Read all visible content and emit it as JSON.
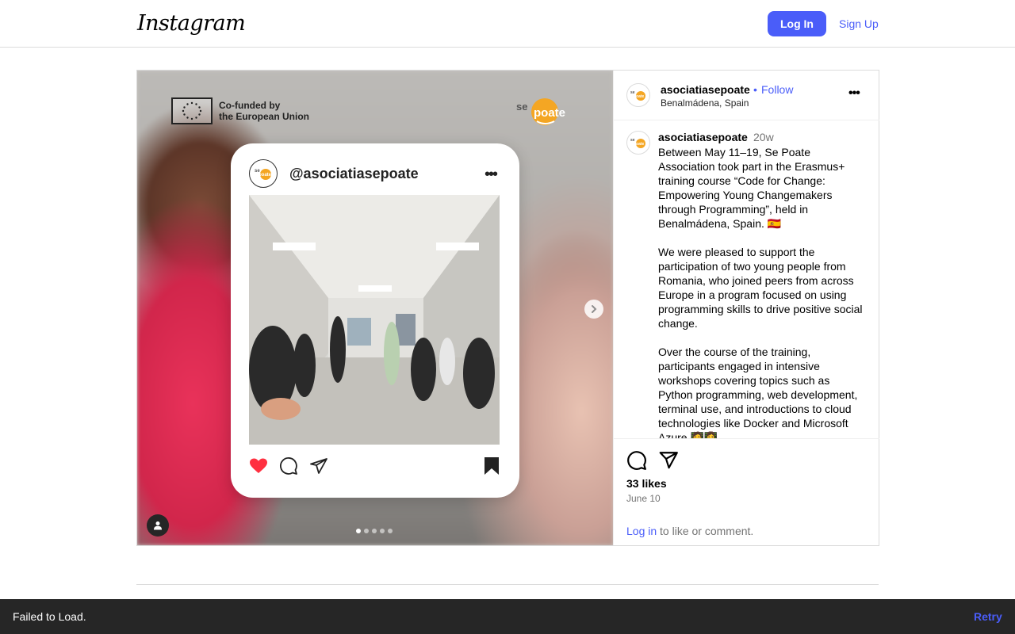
{
  "header": {
    "logo": "Instagram",
    "login_label": "Log In",
    "signup_label": "Sign Up"
  },
  "media": {
    "eu_text_line1": "Co-funded by",
    "eu_text_line2": "the European Union",
    "brand_badge": "se poate",
    "card_handle": "@asociatiasepoate",
    "carousel_count": 5,
    "carousel_active": 1
  },
  "post": {
    "username": "asociatiasepoate",
    "separator": "•",
    "follow_label": "Follow",
    "location": "Benalmádena, Spain",
    "more_label": "•••",
    "caption_username": "asociatiasepoate",
    "caption_time": "20w",
    "caption": "Between May 11–19, Se Poate Association took part in the Erasmus+ training course “Code for Change: Empowering Young Changemakers through Programming”, held in Benalmádena, Spain. 🇪🇸\n\nWe were pleased to support the participation of two young people from Romania, who joined peers from across Europe in a program focused on using programming skills to drive positive social change.\n\nOver the course of the training, participants engaged in intensive workshops covering topics such as Python programming, web development, terminal use, and introductions to cloud technologies like Docker and Microsoft Azure 🧑‍💻👩‍💻",
    "likes": "33 likes",
    "date": "June 10",
    "login_link": "Log in",
    "login_suffix": " to like or comment."
  },
  "toast": {
    "message": "Failed to Load.",
    "retry_label": "Retry"
  },
  "colors": {
    "accent": "#4a5df9",
    "toast_bg": "#262626",
    "border": "#dbdbdb"
  }
}
